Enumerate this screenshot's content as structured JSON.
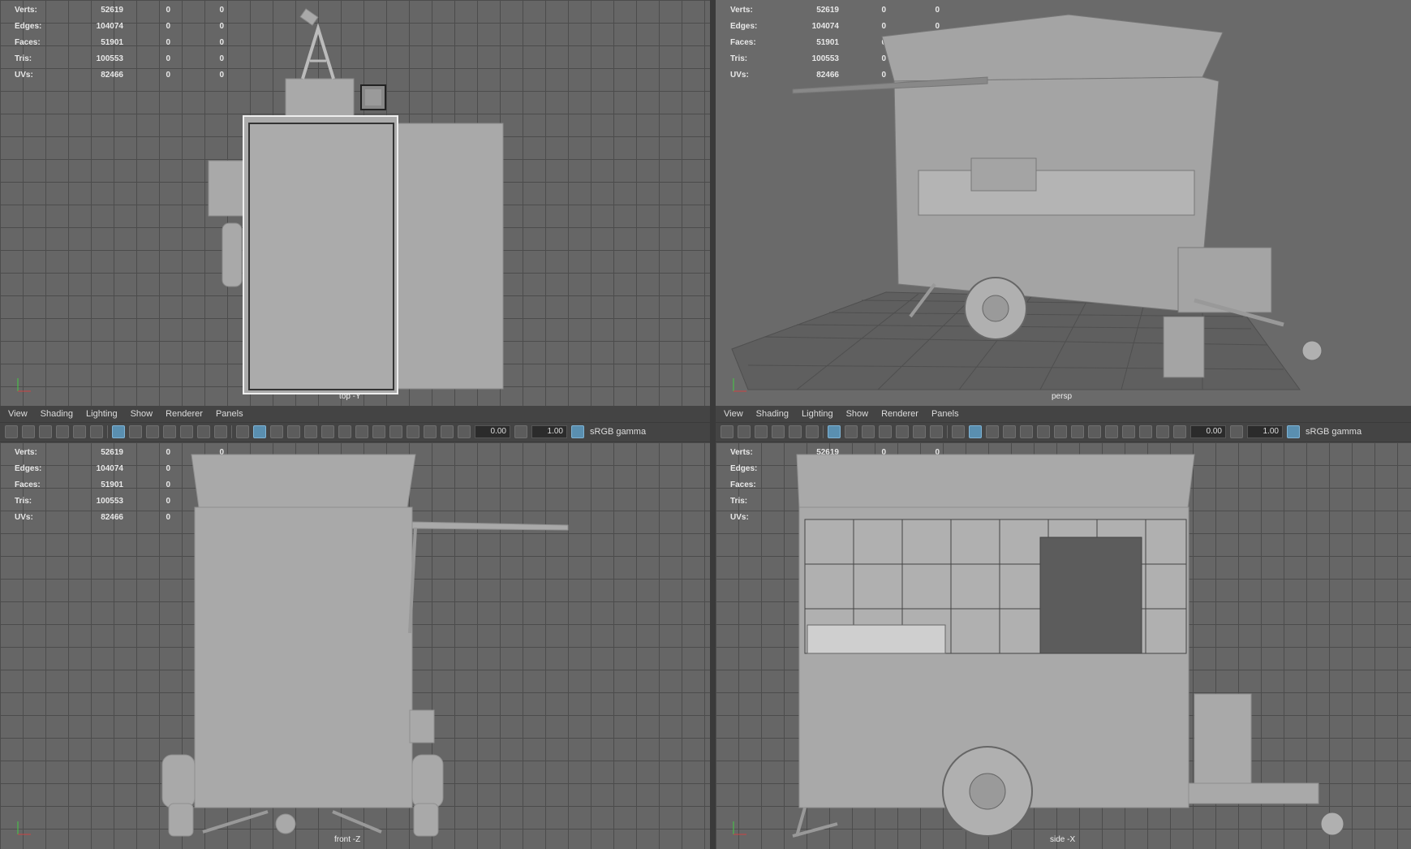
{
  "stats": {
    "rows": [
      {
        "label": "Verts:",
        "v1": "52619",
        "v2": "0",
        "v3": "0"
      },
      {
        "label": "Edges:",
        "v1": "104074",
        "v2": "0",
        "v3": "0"
      },
      {
        "label": "Faces:",
        "v1": "51901",
        "v2": "0",
        "v3": "0"
      },
      {
        "label": "Tris:",
        "v1": "100553",
        "v2": "0",
        "v3": "0"
      },
      {
        "label": "UVs:",
        "v1": "82466",
        "v2": "0",
        "v3": "0"
      }
    ]
  },
  "viewports": {
    "top_left": {
      "camera": "top -Y"
    },
    "top_right": {
      "camera": "persp"
    },
    "bottom_left": {
      "camera": "front -Z"
    },
    "bottom_right": {
      "camera": "side -X"
    }
  },
  "panel_menu": {
    "view": "View",
    "shading": "Shading",
    "lighting": "Lighting",
    "show": "Show",
    "renderer": "Renderer",
    "panels": "Panels"
  },
  "panel_toolbar": {
    "exposure": "0.00",
    "gamma_value": "1.00",
    "color_space": "sRGB gamma"
  },
  "colors": {
    "accent": "#5a8fb0",
    "viewport_bg": "#666666",
    "model": "#a9a9a9"
  }
}
